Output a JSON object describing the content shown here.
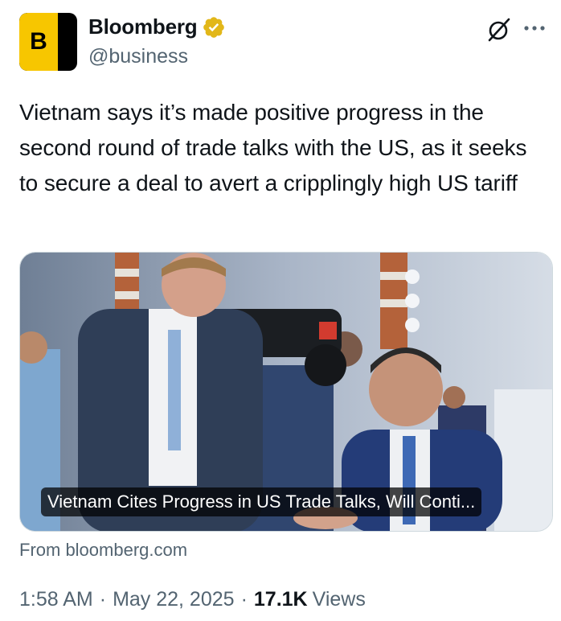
{
  "author": {
    "display_name": "Bloomberg",
    "handle": "@business",
    "avatar_letter": "B",
    "avatar_colors": {
      "yellow": "#f7c600",
      "black": "#000000"
    },
    "verified_badge_color": "#e2b719"
  },
  "tweet": {
    "text": "Vietnam says it’s made positive progress in the second round of trade talks with the US, as it seeks to secure a deal to avert a cripplingly high US tariff"
  },
  "card": {
    "title": "Vietnam Cites Progress in US Trade Talks, Will Conti...",
    "source": "From bloomberg.com",
    "photo_description_icon": "news-photo"
  },
  "meta": {
    "time": "1:58 AM",
    "separator": "·",
    "date": "May 22, 2025",
    "views_count": "17.1K",
    "views_label": "Views"
  },
  "icons": {
    "grok": "grok-icon",
    "more": "more-icon"
  }
}
